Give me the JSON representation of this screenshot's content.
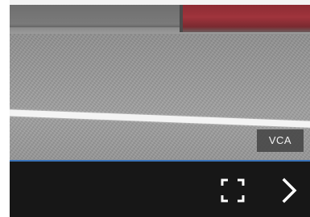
{
  "overlay": {
    "badge_label": "VCA"
  },
  "controls": {
    "fullscreen_icon": "fullscreen-icon",
    "next_icon": "chevron-right-icon",
    "icon_color": "#ffffff",
    "accent_line_color": "#3a73b8"
  }
}
